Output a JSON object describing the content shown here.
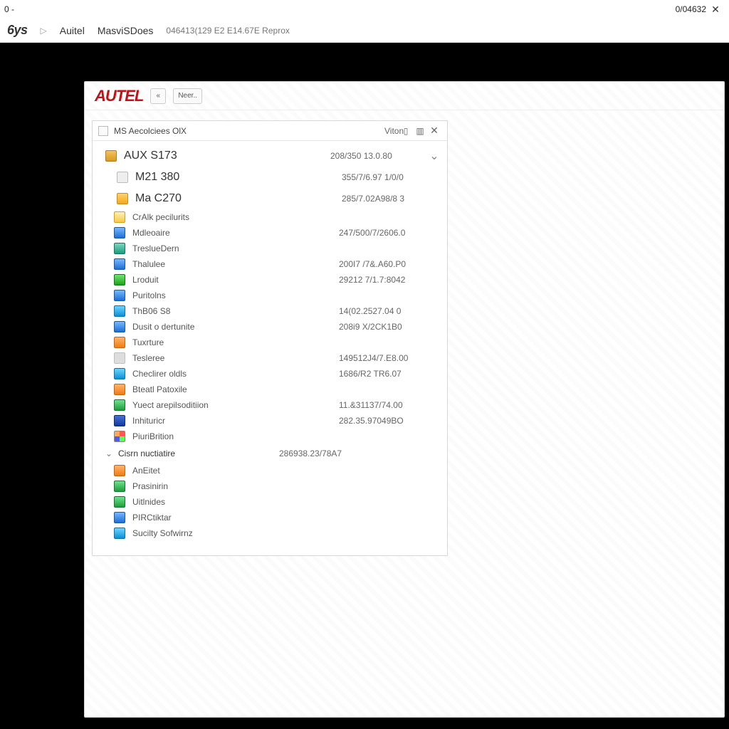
{
  "titlebar": {
    "left": "0 -",
    "right": "0/04632"
  },
  "nav": {
    "logo": "6ys",
    "sep": "▷",
    "crumb1": "Auitel",
    "crumb2": "MasviSDoes",
    "crumb3": "046413(129 E2 E14.67E Reprox"
  },
  "app": {
    "brand": "AUTEL",
    "tools": {
      "back": "«",
      "next": "Neer.."
    },
    "panel": {
      "title": "MS Aecolciees OlX",
      "col_label": "Viton"
    },
    "rows": [
      {
        "kind": "top",
        "icon": "i-hdd",
        "label": "AUX S173",
        "value": "208/350 13.0.80",
        "chev": true
      },
      {
        "kind": "big",
        "icon": "i-disk",
        "label": "M21 380",
        "value": "355/7/6.97 1/0/0"
      },
      {
        "kind": "big",
        "icon": "i-box",
        "label": "Ma C270",
        "value": "285/7.02A98/8 3"
      },
      {
        "kind": "",
        "icon": "i-fold",
        "label": "CrAlk pecilurits",
        "value": ""
      },
      {
        "kind": "",
        "icon": "i-blue",
        "label": "Mdleoaire",
        "value": "247/500/7/2606.0"
      },
      {
        "kind": "",
        "icon": "i-teal",
        "label": "TreslueDern",
        "value": ""
      },
      {
        "kind": "",
        "icon": "i-blue",
        "label": "Thalulee",
        "value": "200I7 /7&.A60.P0"
      },
      {
        "kind": "",
        "icon": "i-chip",
        "label": "Lroduit",
        "value": "29212 7/1.7:8042"
      },
      {
        "kind": "",
        "icon": "i-blue",
        "label": "Puritolns",
        "value": ""
      },
      {
        "kind": "",
        "icon": "i-cyan",
        "label": "ThB06 S8",
        "value": "14(02.2527.04 0"
      },
      {
        "kind": "",
        "icon": "i-blue",
        "label": "Dusit o dertunite",
        "value": "208i9 X/2CK1B0"
      },
      {
        "kind": "",
        "icon": "i-orn",
        "label": "Tuxrture",
        "value": ""
      },
      {
        "kind": "",
        "icon": "i-gray",
        "label": "Tesleree",
        "value": "149512J4/7.E8.00"
      },
      {
        "kind": "",
        "icon": "i-cyan",
        "label": "Checlirer oldls",
        "value": "1686/R2 TR6.07"
      },
      {
        "kind": "",
        "icon": "i-orn",
        "label": "Bteatl Patoxile",
        "value": ""
      },
      {
        "kind": "",
        "icon": "i-green",
        "label": "Yuect arepilsoditiion",
        "value": "11.&31137/74.00"
      },
      {
        "kind": "",
        "icon": "i-navy",
        "label": "Inhituricr",
        "value": "282.35.97049BO"
      },
      {
        "kind": "",
        "icon": "i-mix",
        "label": "PiuriBrition",
        "value": ""
      },
      {
        "kind": "sect",
        "icon": "",
        "label": "Cisrn nuctiatire",
        "value": "286938.23/78A7"
      },
      {
        "kind": "",
        "icon": "i-orn",
        "label": "AnEitet",
        "value": ""
      },
      {
        "kind": "",
        "icon": "i-green",
        "label": "Prasinirin",
        "value": ""
      },
      {
        "kind": "",
        "icon": "i-green",
        "label": "Uitlnides",
        "value": ""
      },
      {
        "kind": "",
        "icon": "i-blue",
        "label": "PIRCtiktar",
        "value": ""
      },
      {
        "kind": "",
        "icon": "i-cyan",
        "label": "Sucilty Sofwirnz",
        "value": ""
      }
    ]
  }
}
